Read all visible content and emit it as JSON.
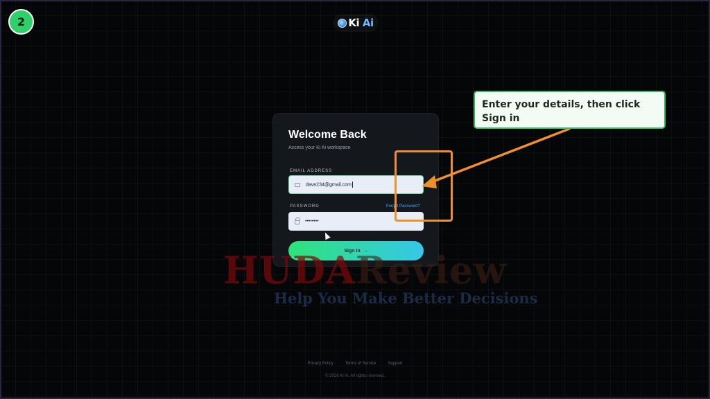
{
  "step": {
    "number": "2"
  },
  "logo": {
    "text_main": "Ki",
    "text_accent": "Ai"
  },
  "card": {
    "title": "Welcome Back",
    "subtitle": "Access your Ki Ai workspace",
    "email": {
      "label": "EMAIL ADDRESS",
      "value": "dave234@gmail.com"
    },
    "password": {
      "label": "PASSWORD",
      "value": "••••••••",
      "forgot_label": "Forgot Password?"
    },
    "signin": {
      "label": "Sign In",
      "arrow": "→"
    }
  },
  "callout": {
    "text": "Enter your details, then click Sign in"
  },
  "watermark": {
    "word1": "HUDA",
    "word2": "Review",
    "tagline": "Help You Make Better Decisions"
  },
  "footer": {
    "links": [
      "Privacy Policy",
      "Terms of Service",
      "Support"
    ],
    "copyright": "© 2026 Ki Ai. All rights reserved."
  },
  "colors": {
    "accent_green": "#2ee37a",
    "accent_cyan": "#36c7e8",
    "annotation_orange": "#f0902a",
    "callout_border": "#36b86a"
  }
}
